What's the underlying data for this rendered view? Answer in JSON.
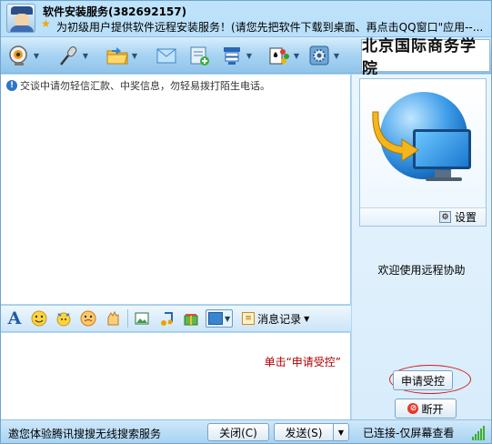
{
  "header": {
    "contact_name": "软件安装服务(382692157)",
    "signature": "为初级用户提供软件远程安装服务！(请您先把软件下载到桌面、再点击QQ窗口\"应用--..."
  },
  "toolbar": {
    "buttons": [
      {
        "name": "video-chat",
        "icon": "webcam-icon"
      },
      {
        "name": "voice-chat",
        "icon": "microphone-icon"
      },
      {
        "name": "send-file",
        "icon": "folder-icon"
      },
      {
        "name": "send-sms",
        "icon": "mail-icon"
      },
      {
        "name": "create-group",
        "icon": "add-contact-icon"
      },
      {
        "name": "remote-assist",
        "icon": "remote-icon"
      },
      {
        "name": "apps",
        "icon": "games-icon"
      },
      {
        "name": "settings",
        "icon": "gear-icon"
      }
    ],
    "logo_text": "北京国际商务学院"
  },
  "chat": {
    "notice": "交谈中请勿轻信汇款、中奖信息，勿轻易拨打陌生电话。"
  },
  "format_bar": {
    "message_record_label": "消息记录"
  },
  "input": {
    "hint_text": "单击“申请受控”"
  },
  "right_panel": {
    "settings_label": "设置",
    "welcome_text": "欢迎使用远程协助",
    "apply_button": "申请受控",
    "disconnect_button": "断开"
  },
  "bottom": {
    "ad_text": "邀您体验腾讯搜搜无线搜索服务",
    "close_button": "关闭(C)",
    "send_button": "发送(S)",
    "status_text": "已连接-仅屏幕查看"
  },
  "colors": {
    "accent_blue": "#9fd0f3",
    "hint_red": "#b00000",
    "ring_red": "#d21f1f"
  }
}
